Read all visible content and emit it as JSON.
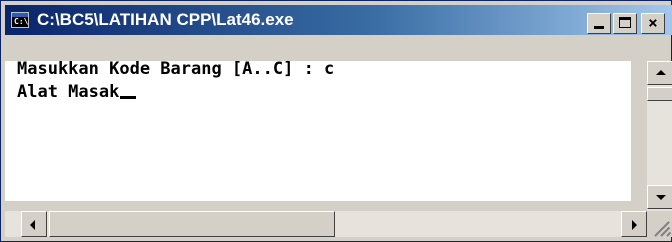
{
  "window": {
    "title": "C:\\BC5\\LATIHAN CPP\\Lat46.exe",
    "icon": "console-app-icon",
    "icon_text": "C:\\",
    "controls": [
      "minimize",
      "maximize",
      "close"
    ]
  },
  "console": {
    "lines": [
      "Masukkan Kode Barang [A..C] : c",
      "Alat Masak"
    ],
    "cursor": "_"
  },
  "colors": {
    "titlebar_start": "#0a246a",
    "titlebar_end": "#a6caf0",
    "console_bg": "#ffffff",
    "console_text": "#000000",
    "chrome": "#d4d0c8"
  }
}
